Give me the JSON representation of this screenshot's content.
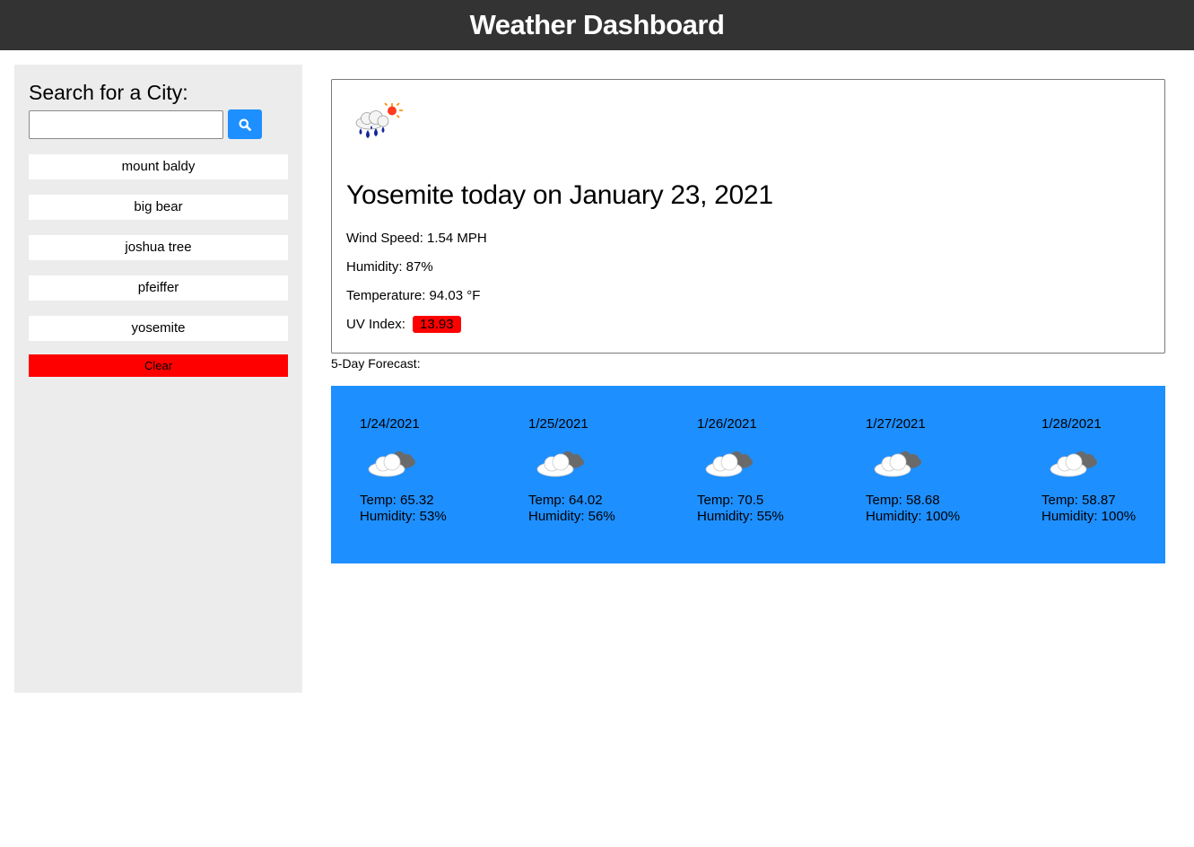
{
  "header": {
    "title": "Weather Dashboard"
  },
  "search": {
    "title": "Search for a City:",
    "placeholder": "",
    "value": ""
  },
  "history": [
    {
      "label": "mount baldy"
    },
    {
      "label": "big bear"
    },
    {
      "label": "joshua tree"
    },
    {
      "label": "pfeiffer"
    },
    {
      "label": "yosemite"
    }
  ],
  "clear_label": "Clear",
  "current": {
    "icon": "rain-sun-icon",
    "title": "Yosemite today on January 23, 2021",
    "wind": "Wind Speed: 1.54 MPH",
    "humidity": "Humidity: 87%",
    "temperature": "Temperature: 94.03 °F",
    "uv_label": "UV Index:",
    "uv_value": "13.93",
    "uv_color": "#ff0000"
  },
  "forecast_label": "5-Day Forecast:",
  "forecast": [
    {
      "date": "1/24/2021",
      "icon": "cloudy-icon",
      "temp": "Temp: 65.32",
      "humidity": "Humidity: 53%"
    },
    {
      "date": "1/25/2021",
      "icon": "cloudy-icon",
      "temp": "Temp: 64.02",
      "humidity": "Humidity: 56%"
    },
    {
      "date": "1/26/2021",
      "icon": "cloudy-icon",
      "temp": "Temp: 70.5",
      "humidity": "Humidity: 55%"
    },
    {
      "date": "1/27/2021",
      "icon": "cloudy-icon",
      "temp": "Temp: 58.68",
      "humidity": "Humidity: 100%"
    },
    {
      "date": "1/28/2021",
      "icon": "cloudy-icon",
      "temp": "Temp: 58.87",
      "humidity": "Humidity: 100%"
    }
  ],
  "colors": {
    "header_bg": "#333333",
    "accent": "#1e8fff",
    "danger": "#ff0000",
    "sidebar_bg": "#ececec"
  }
}
